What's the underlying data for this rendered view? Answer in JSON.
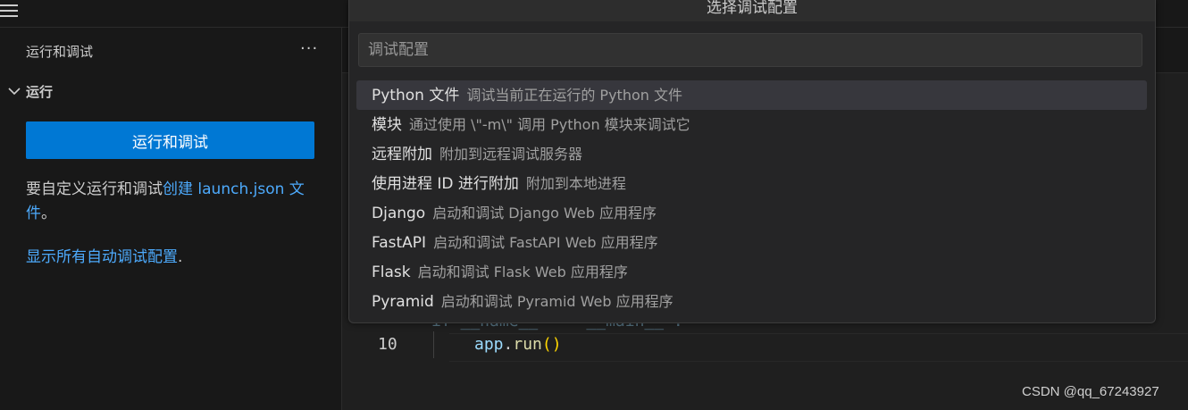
{
  "sidebar": {
    "title": "运行和调试",
    "more": "···",
    "section_label": "运行",
    "run_button": "运行和调试",
    "help_text": "要自定义运行和调试",
    "help_link": "创建 launch.json 文件",
    "help_end": "。",
    "show_all_link": "显示所有自动调试配置",
    "show_all_end": "."
  },
  "quick_pick": {
    "title": "选择调试配置",
    "placeholder": "调试配置",
    "items": [
      {
        "label": "Python 文件",
        "description": "调试当前正在运行的 Python 文件"
      },
      {
        "label": "模块",
        "description": "通过使用 \\\"-m\\\" 调用 Python 模块来调试它"
      },
      {
        "label": "远程附加",
        "description": "附加到远程调试服务器"
      },
      {
        "label": "使用进程 ID 进行附加",
        "description": "附加到本地进程"
      },
      {
        "label": "Django",
        "description": "启动和调试 Django Web 应用程序"
      },
      {
        "label": "FastAPI",
        "description": "启动和调试 FastAPI Web 应用程序"
      },
      {
        "label": "Flask",
        "description": "启动和调试 Flask Web 应用程序"
      },
      {
        "label": "Pyramid",
        "description": "启动和调试 Pyramid Web 应用程序"
      }
    ]
  },
  "editor": {
    "partial_line": "if __name__ == '__main__':",
    "line_number": "10",
    "code_obj": "app",
    "code_dot": ".",
    "code_fn": "run",
    "code_paren": "()"
  },
  "watermark": "CSDN @qq_67243927",
  "colors": {
    "accent": "#0078d4",
    "link": "#4daafc"
  }
}
